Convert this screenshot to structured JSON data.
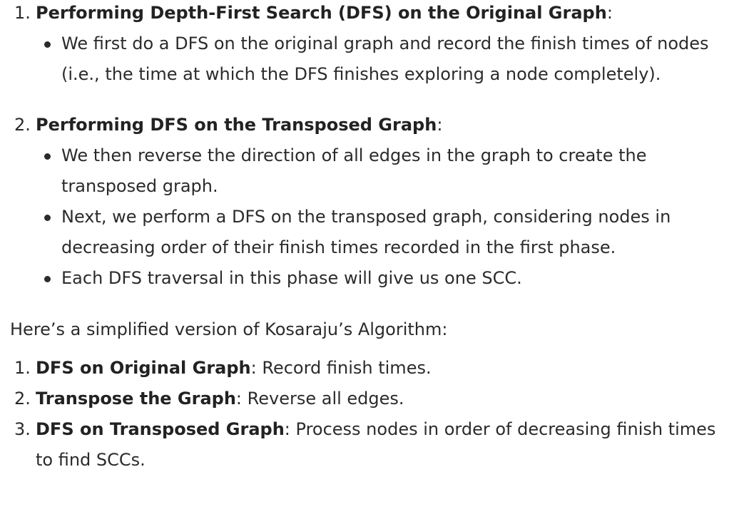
{
  "phases": [
    {
      "number": "1.",
      "title": "Performing Depth-First Search (DFS) on the Original Graph",
      "suffix": ":",
      "bullets": [
        "We first do a DFS on the original graph and record the finish times of nodes (i.e., the time at which the DFS finishes exploring a node completely)."
      ]
    },
    {
      "number": "2.",
      "title": "Performing DFS on the Transposed Graph",
      "suffix": ":",
      "bullets": [
        "We then reverse the direction of all edges in the graph to create the transposed graph.",
        "Next, we perform a DFS on the transposed graph, considering nodes in decreasing order of their finish times recorded in the first phase.",
        "Each DFS traversal in this phase will give us one SCC."
      ]
    }
  ],
  "summary": {
    "intro": "Here’s a simplified version of Kosaraju’s Algorithm:",
    "items": [
      {
        "number": "1.",
        "title": "DFS on Original Graph",
        "text": ": Record finish times."
      },
      {
        "number": "2.",
        "title": "Transpose the Graph",
        "text": ": Reverse all edges."
      },
      {
        "number": "3.",
        "title": "DFS on Transposed Graph",
        "text": ": Process nodes in order of decreasing finish times to find SCCs."
      }
    ]
  }
}
